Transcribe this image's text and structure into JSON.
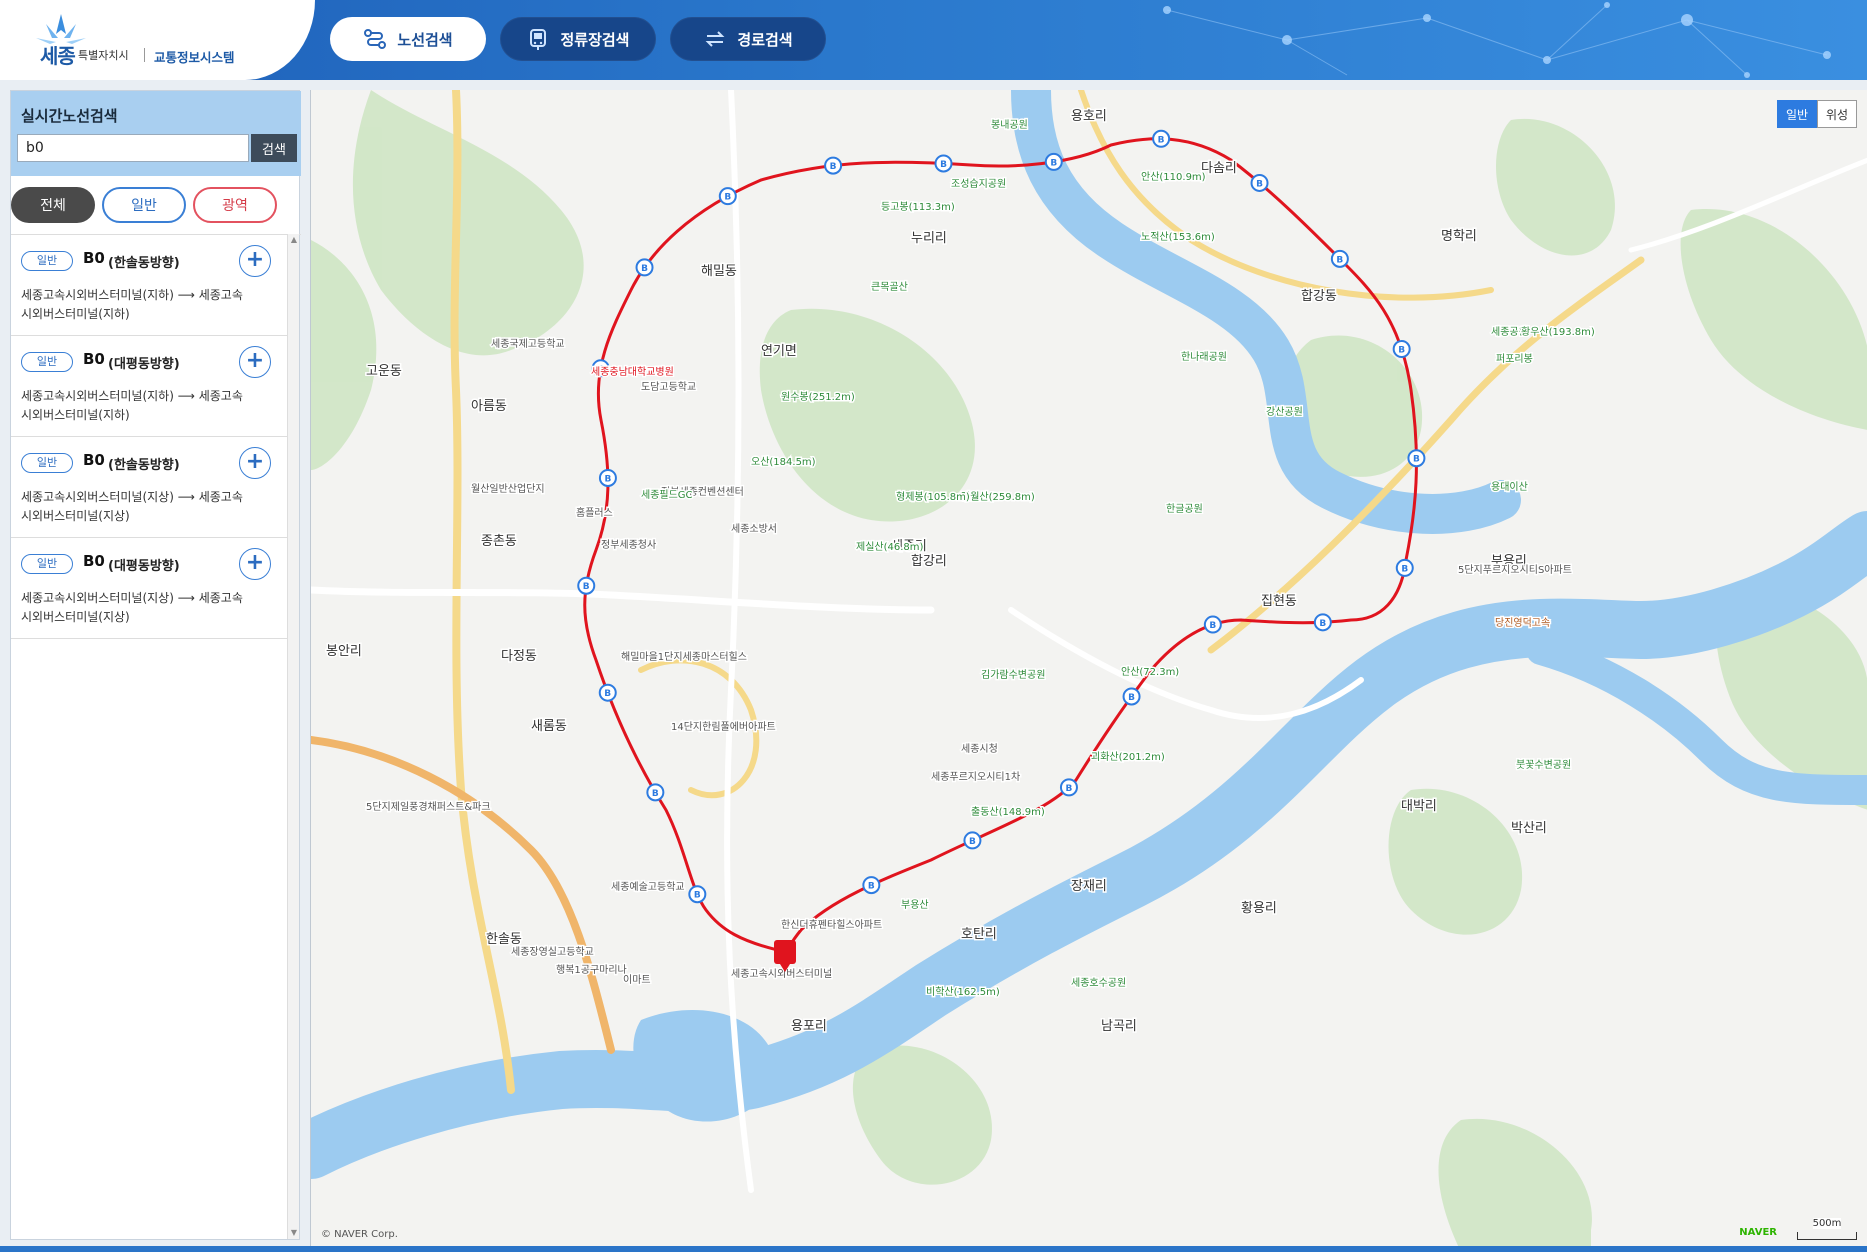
{
  "header": {
    "logo_city": "세종",
    "logo_special": "특별자치시",
    "logo_system": "교통정보시스템",
    "tabs": [
      {
        "label": "노선검색",
        "icon": "route-search-icon",
        "active": true
      },
      {
        "label": "정류장검색",
        "icon": "bus-stop-icon",
        "active": false
      },
      {
        "label": "경로검색",
        "icon": "path-swap-icon",
        "active": false
      }
    ]
  },
  "sidebar": {
    "title": "실시간노선검색",
    "search": {
      "value": "b0",
      "button": "검색"
    },
    "filters": {
      "all": "전체",
      "general": "일반",
      "wide": "광역"
    },
    "routes": [
      {
        "badge": "일반",
        "name": "B0",
        "direction": "(한솔동방향)",
        "desc": "세종고속시외버스터미널(지하) ⟶ 세종고속시외버스터미널(지하)"
      },
      {
        "badge": "일반",
        "name": "B0",
        "direction": "(대평동방향)",
        "desc": "세종고속시외버스터미널(지하) ⟶ 세종고속시외버스터미널(지하)"
      },
      {
        "badge": "일반",
        "name": "B0",
        "direction": "(한솔동방향)",
        "desc": "세종고속시외버스터미널(지상) ⟶ 세종고속시외버스터미널(지상)"
      },
      {
        "badge": "일반",
        "name": "B0",
        "direction": "(대평동방향)",
        "desc": "세종고속시외버스터미널(지상) ⟶ 세종고속시외버스터미널(지상)"
      }
    ]
  },
  "map": {
    "toggle": {
      "general": "일반",
      "satellite": "위성"
    },
    "copyright": "© NAVER Corp.",
    "naver": "NAVER",
    "scale": "500m",
    "route_color": "#e0141e",
    "river_color": "#9ccbf0",
    "labels": [
      {
        "t": "용호리",
        "k": "place"
      },
      {
        "t": "다솜리",
        "k": "place"
      },
      {
        "t": "누리리",
        "k": "place"
      },
      {
        "t": "해밀동",
        "k": "place"
      },
      {
        "t": "연기면",
        "k": "place"
      },
      {
        "t": "명학리",
        "k": "place"
      },
      {
        "t": "합강동",
        "k": "place"
      },
      {
        "t": "합강리",
        "k": "place"
      },
      {
        "t": "아름동",
        "k": "place"
      },
      {
        "t": "고운동",
        "k": "place"
      },
      {
        "t": "종촌동",
        "k": "place"
      },
      {
        "t": "세종리",
        "k": "place"
      },
      {
        "t": "다정동",
        "k": "place"
      },
      {
        "t": "봉안리",
        "k": "place"
      },
      {
        "t": "새롬동",
        "k": "place"
      },
      {
        "t": "집현동",
        "k": "place"
      },
      {
        "t": "부용리",
        "k": "place"
      },
      {
        "t": "대박리",
        "k": "place"
      },
      {
        "t": "박산리",
        "k": "place"
      },
      {
        "t": "장재리",
        "k": "place"
      },
      {
        "t": "황용리",
        "k": "place"
      },
      {
        "t": "호탄리",
        "k": "place"
      },
      {
        "t": "남곡리",
        "k": "place"
      },
      {
        "t": "용포리",
        "k": "place"
      },
      {
        "t": "한솔동",
        "k": "place"
      },
      {
        "t": "안산(72.3m)",
        "k": "mount"
      },
      {
        "t": "노적산(153.6m)",
        "k": "mount"
      },
      {
        "t": "전월산(259.8m)",
        "k": "mount"
      },
      {
        "t": "원수봉(251.2m)",
        "k": "mount"
      },
      {
        "t": "오산(184.5m)",
        "k": "mount"
      },
      {
        "t": "형제봉(105.8m)",
        "k": "mount"
      },
      {
        "t": "제실산(46.8m)",
        "k": "mount"
      },
      {
        "t": "괴화산(201.2m)",
        "k": "mount"
      },
      {
        "t": "비학산(162.5m)",
        "k": "mount"
      },
      {
        "t": "봉내공원",
        "k": "park"
      },
      {
        "t": "조성습지공원",
        "k": "park"
      },
      {
        "t": "등고봉(113.3m)",
        "k": "mount"
      },
      {
        "t": "큰목골산",
        "k": "park"
      },
      {
        "t": "한나래공원",
        "k": "park"
      },
      {
        "t": "강산공원",
        "k": "park"
      },
      {
        "t": "한글공원",
        "k": "park"
      },
      {
        "t": "김가람수변공원",
        "k": "park"
      },
      {
        "t": "세종국제고등학교",
        "k": "poi"
      },
      {
        "t": "세종충남대학교병원",
        "k": "hospital"
      },
      {
        "t": "정부세종청사",
        "k": "poi"
      },
      {
        "t": "세종소방서",
        "k": "poi"
      },
      {
        "t": "세종시청",
        "k": "poi"
      },
      {
        "t": "세종고속시외버스터미널",
        "k": "poi"
      },
      {
        "t": "세종호수공원",
        "k": "park"
      },
      {
        "t": "홈플러스",
        "k": "poi"
      },
      {
        "t": "정부세종컨벤션센터",
        "k": "poi"
      },
      {
        "t": "도담고등학교",
        "k": "poi"
      },
      {
        "t": "월산일반산업단지",
        "k": "poi"
      },
      {
        "t": "세종필드GC",
        "k": "park"
      },
      {
        "t": "해밀마을1단지세종마스터힐스",
        "k": "poi"
      },
      {
        "t": "14단지한림풀에버아파트",
        "k": "poi"
      },
      {
        "t": "세종푸르지오시티1차",
        "k": "poi"
      },
      {
        "t": "세종예술고등학교",
        "k": "poi"
      },
      {
        "t": "세종장영실고등학교",
        "k": "poi"
      },
      {
        "t": "행복1공구마리나",
        "k": "poi"
      },
      {
        "t": "이마트",
        "k": "poi"
      },
      {
        "t": "붓꽃수변공원",
        "k": "park"
      },
      {
        "t": "세종공원",
        "k": "park"
      },
      {
        "t": "퍼포리봉",
        "k": "mount"
      },
      {
        "t": "황우산(193.8m)",
        "k": "mount"
      },
      {
        "t": "안산(110.9m)",
        "k": "mount"
      },
      {
        "t": "용대이산",
        "k": "mount"
      },
      {
        "t": "출동산(148.9m)",
        "k": "mount"
      },
      {
        "t": "부용산",
        "k": "mount"
      },
      {
        "t": "한신더휴펜타힐스아파트",
        "k": "poi"
      },
      {
        "t": "5단지제일풍경채퍼스트&파크",
        "k": "poi"
      },
      {
        "t": "5단지푸르지오시티S아파트",
        "k": "poi"
      },
      {
        "t": "당진영덕고속",
        "k": "road"
      }
    ]
  }
}
